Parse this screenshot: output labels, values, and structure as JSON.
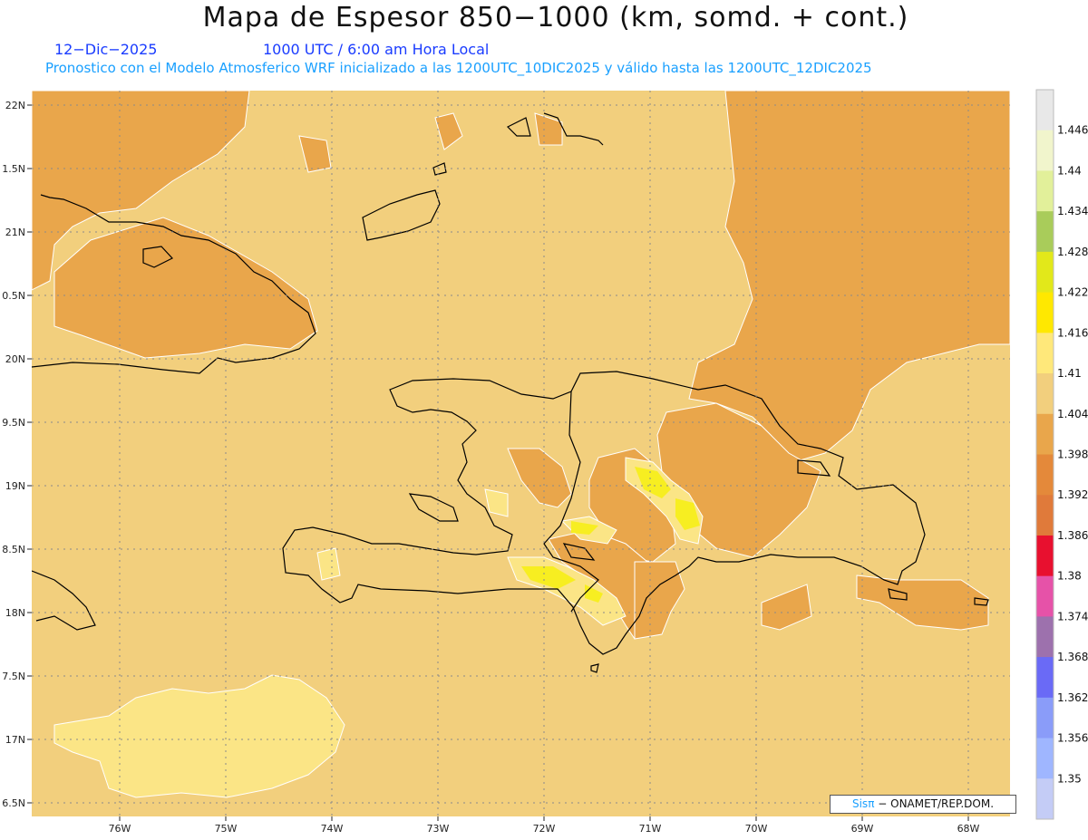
{
  "header": {
    "title": "Mapa de Espesor 850−1000 (km, somd. + cont.)",
    "date": "12−Dic−2025",
    "time": "1000 UTC / 6:00 am Hora Local",
    "info": "Pronostico con el Modelo Atmosferico WRF inicializado a las 1200UTC_10DIC2025 y válido hasta las  1200UTC_12DIC2025"
  },
  "axes": {
    "lat_labels": [
      "22N",
      "1.5N",
      "21N",
      "0.5N",
      "20N",
      "9.5N",
      "19N",
      "8.5N",
      "18N",
      "7.5N",
      "17N",
      "6.5N"
    ],
    "lon_labels": [
      "76W",
      "75W",
      "74W",
      "73W",
      "72W",
      "71W",
      "70W",
      "69W",
      "68W"
    ]
  },
  "colorbar": {
    "labels": [
      "1.446",
      "1.44",
      "1.434",
      "1.428",
      "1.422",
      "1.416",
      "1.41",
      "1.404",
      "1.398",
      "1.392",
      "1.386",
      "1.38",
      "1.374",
      "1.368",
      "1.362",
      "1.356",
      "1.35"
    ],
    "colors": [
      "#e8e8e8",
      "#f1f5cc",
      "#e2f09a",
      "#a9cc5a",
      "#e2e81a",
      "#ffe800",
      "#ffe87a",
      "#f2cf7d",
      "#e9a64b",
      "#e4893a",
      "#e07a3a",
      "#e8102f",
      "#e652a8",
      "#9d71ad",
      "#6a6af6",
      "#8a9cf9",
      "#9fb6ff",
      "#c4ccf6"
    ]
  },
  "map_colors": {
    "background": "#f2cf7d",
    "band_1398": "#e9a64b",
    "band_1410": "#fbe586",
    "band_1416": "#f7ee21"
  },
  "credit": {
    "logo": "Sisπ",
    "text": "− ONAMET/REP.DOM."
  }
}
